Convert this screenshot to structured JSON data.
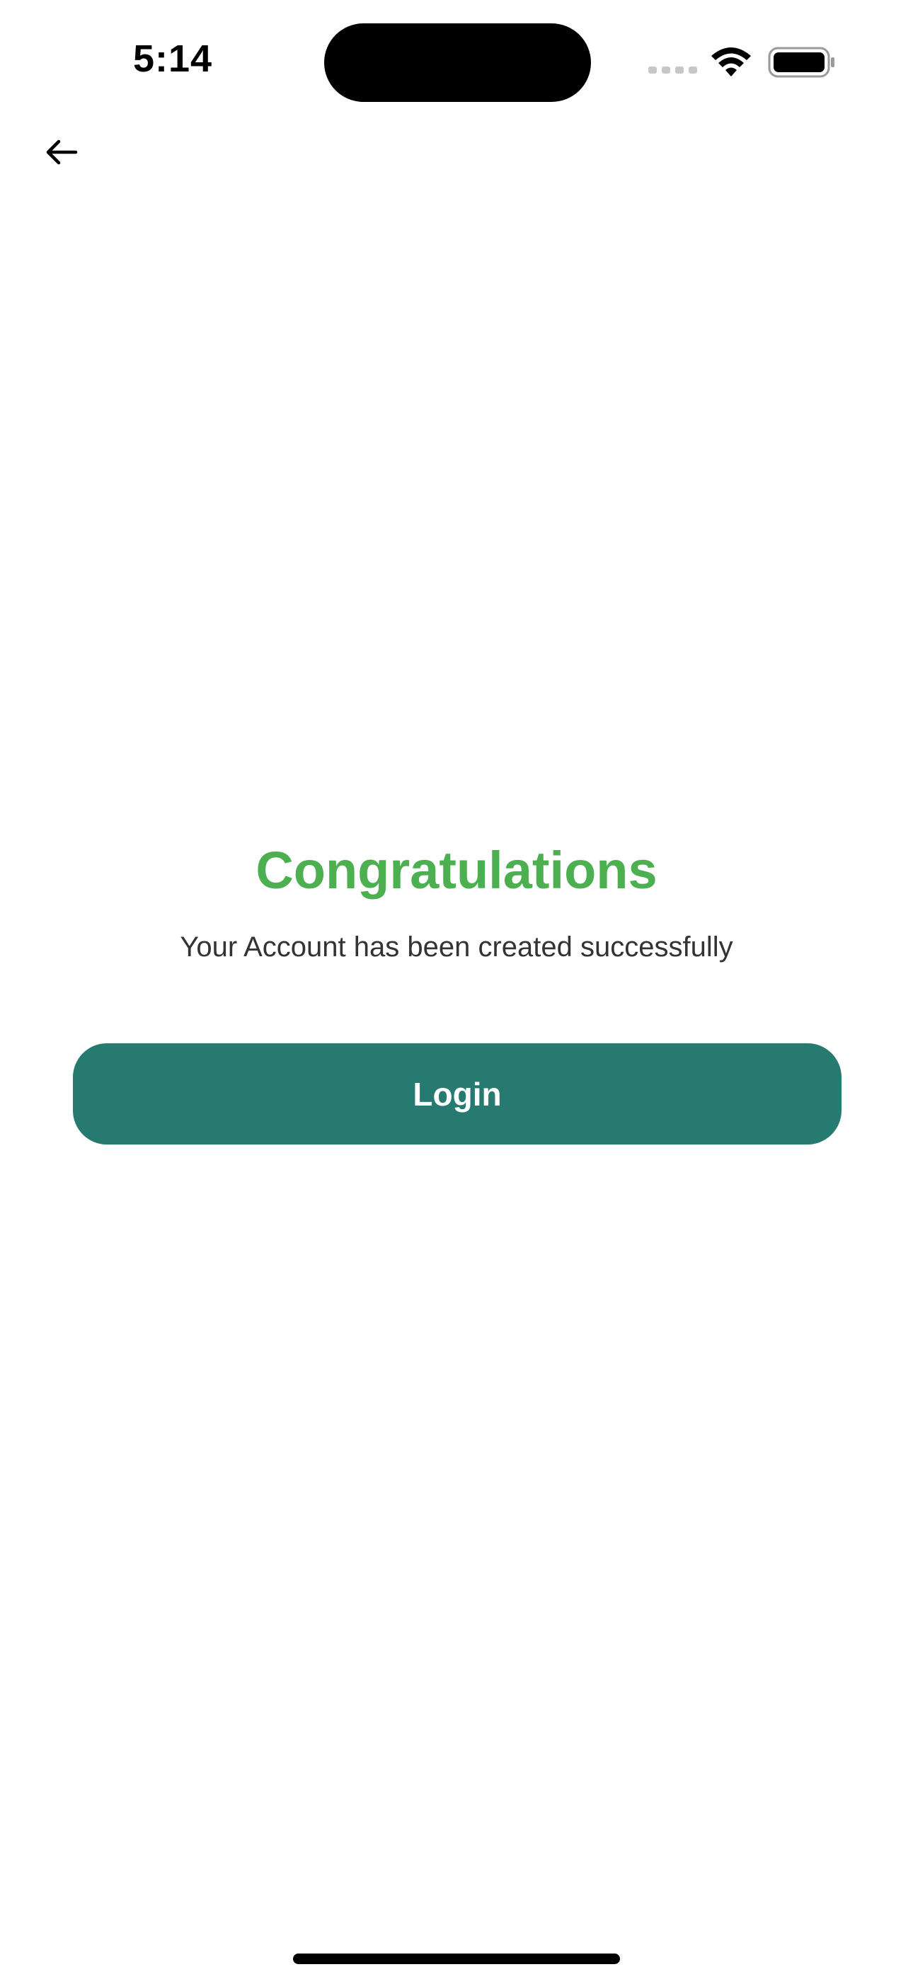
{
  "status_bar": {
    "time": "5:14"
  },
  "header": {
    "back_icon": "arrow-left-icon"
  },
  "main": {
    "title": "Congratulations",
    "message": "Your Account has been created successfully",
    "login_label": "Login"
  },
  "colors": {
    "title_green": "#4caf50",
    "button_teal": "#267a70",
    "background": "#ffffff"
  }
}
